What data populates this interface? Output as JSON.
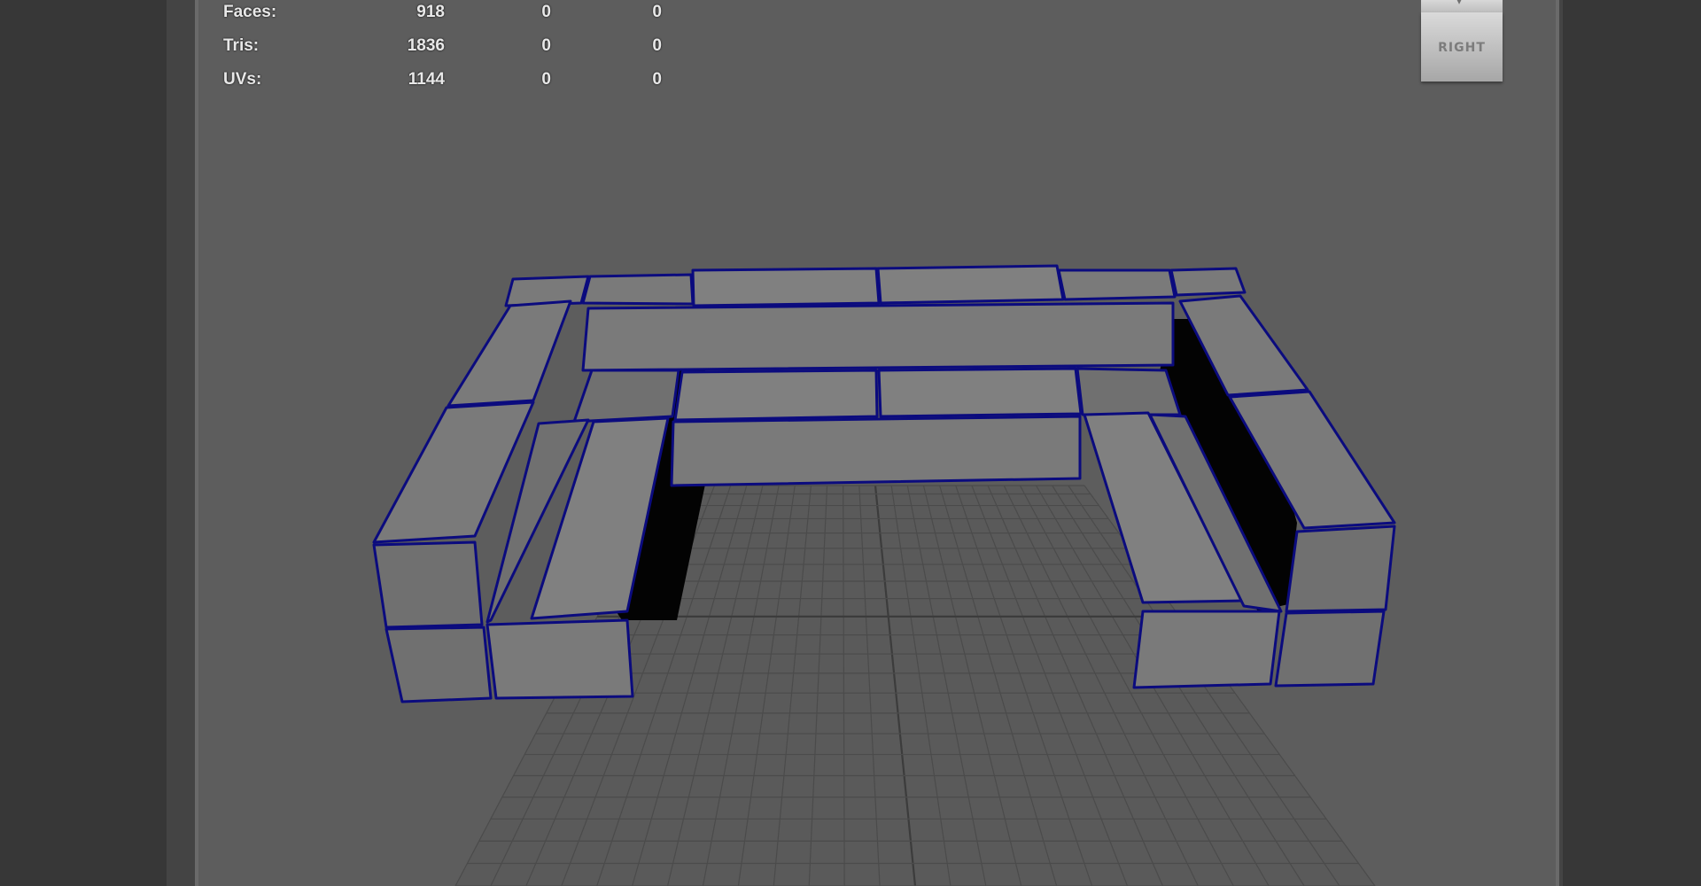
{
  "hud": {
    "rows": [
      {
        "label": "Faces:",
        "value": "918",
        "col2": "0",
        "col3": "0"
      },
      {
        "label": "Tris:",
        "value": "1836",
        "col2": "0",
        "col3": "0"
      },
      {
        "label": "UVs:",
        "value": "1144",
        "col2": "0",
        "col3": "0"
      }
    ]
  },
  "viewcube": {
    "face_label": "RIGHT"
  },
  "colors": {
    "viewport_background": "#5d5d5d",
    "mesh_face": "#7a7a7a",
    "mesh_shadow": "#030303",
    "wireframe": "#0b0b7e",
    "grid": "#4b4b4b",
    "hud_text": "#e8e8e8"
  }
}
